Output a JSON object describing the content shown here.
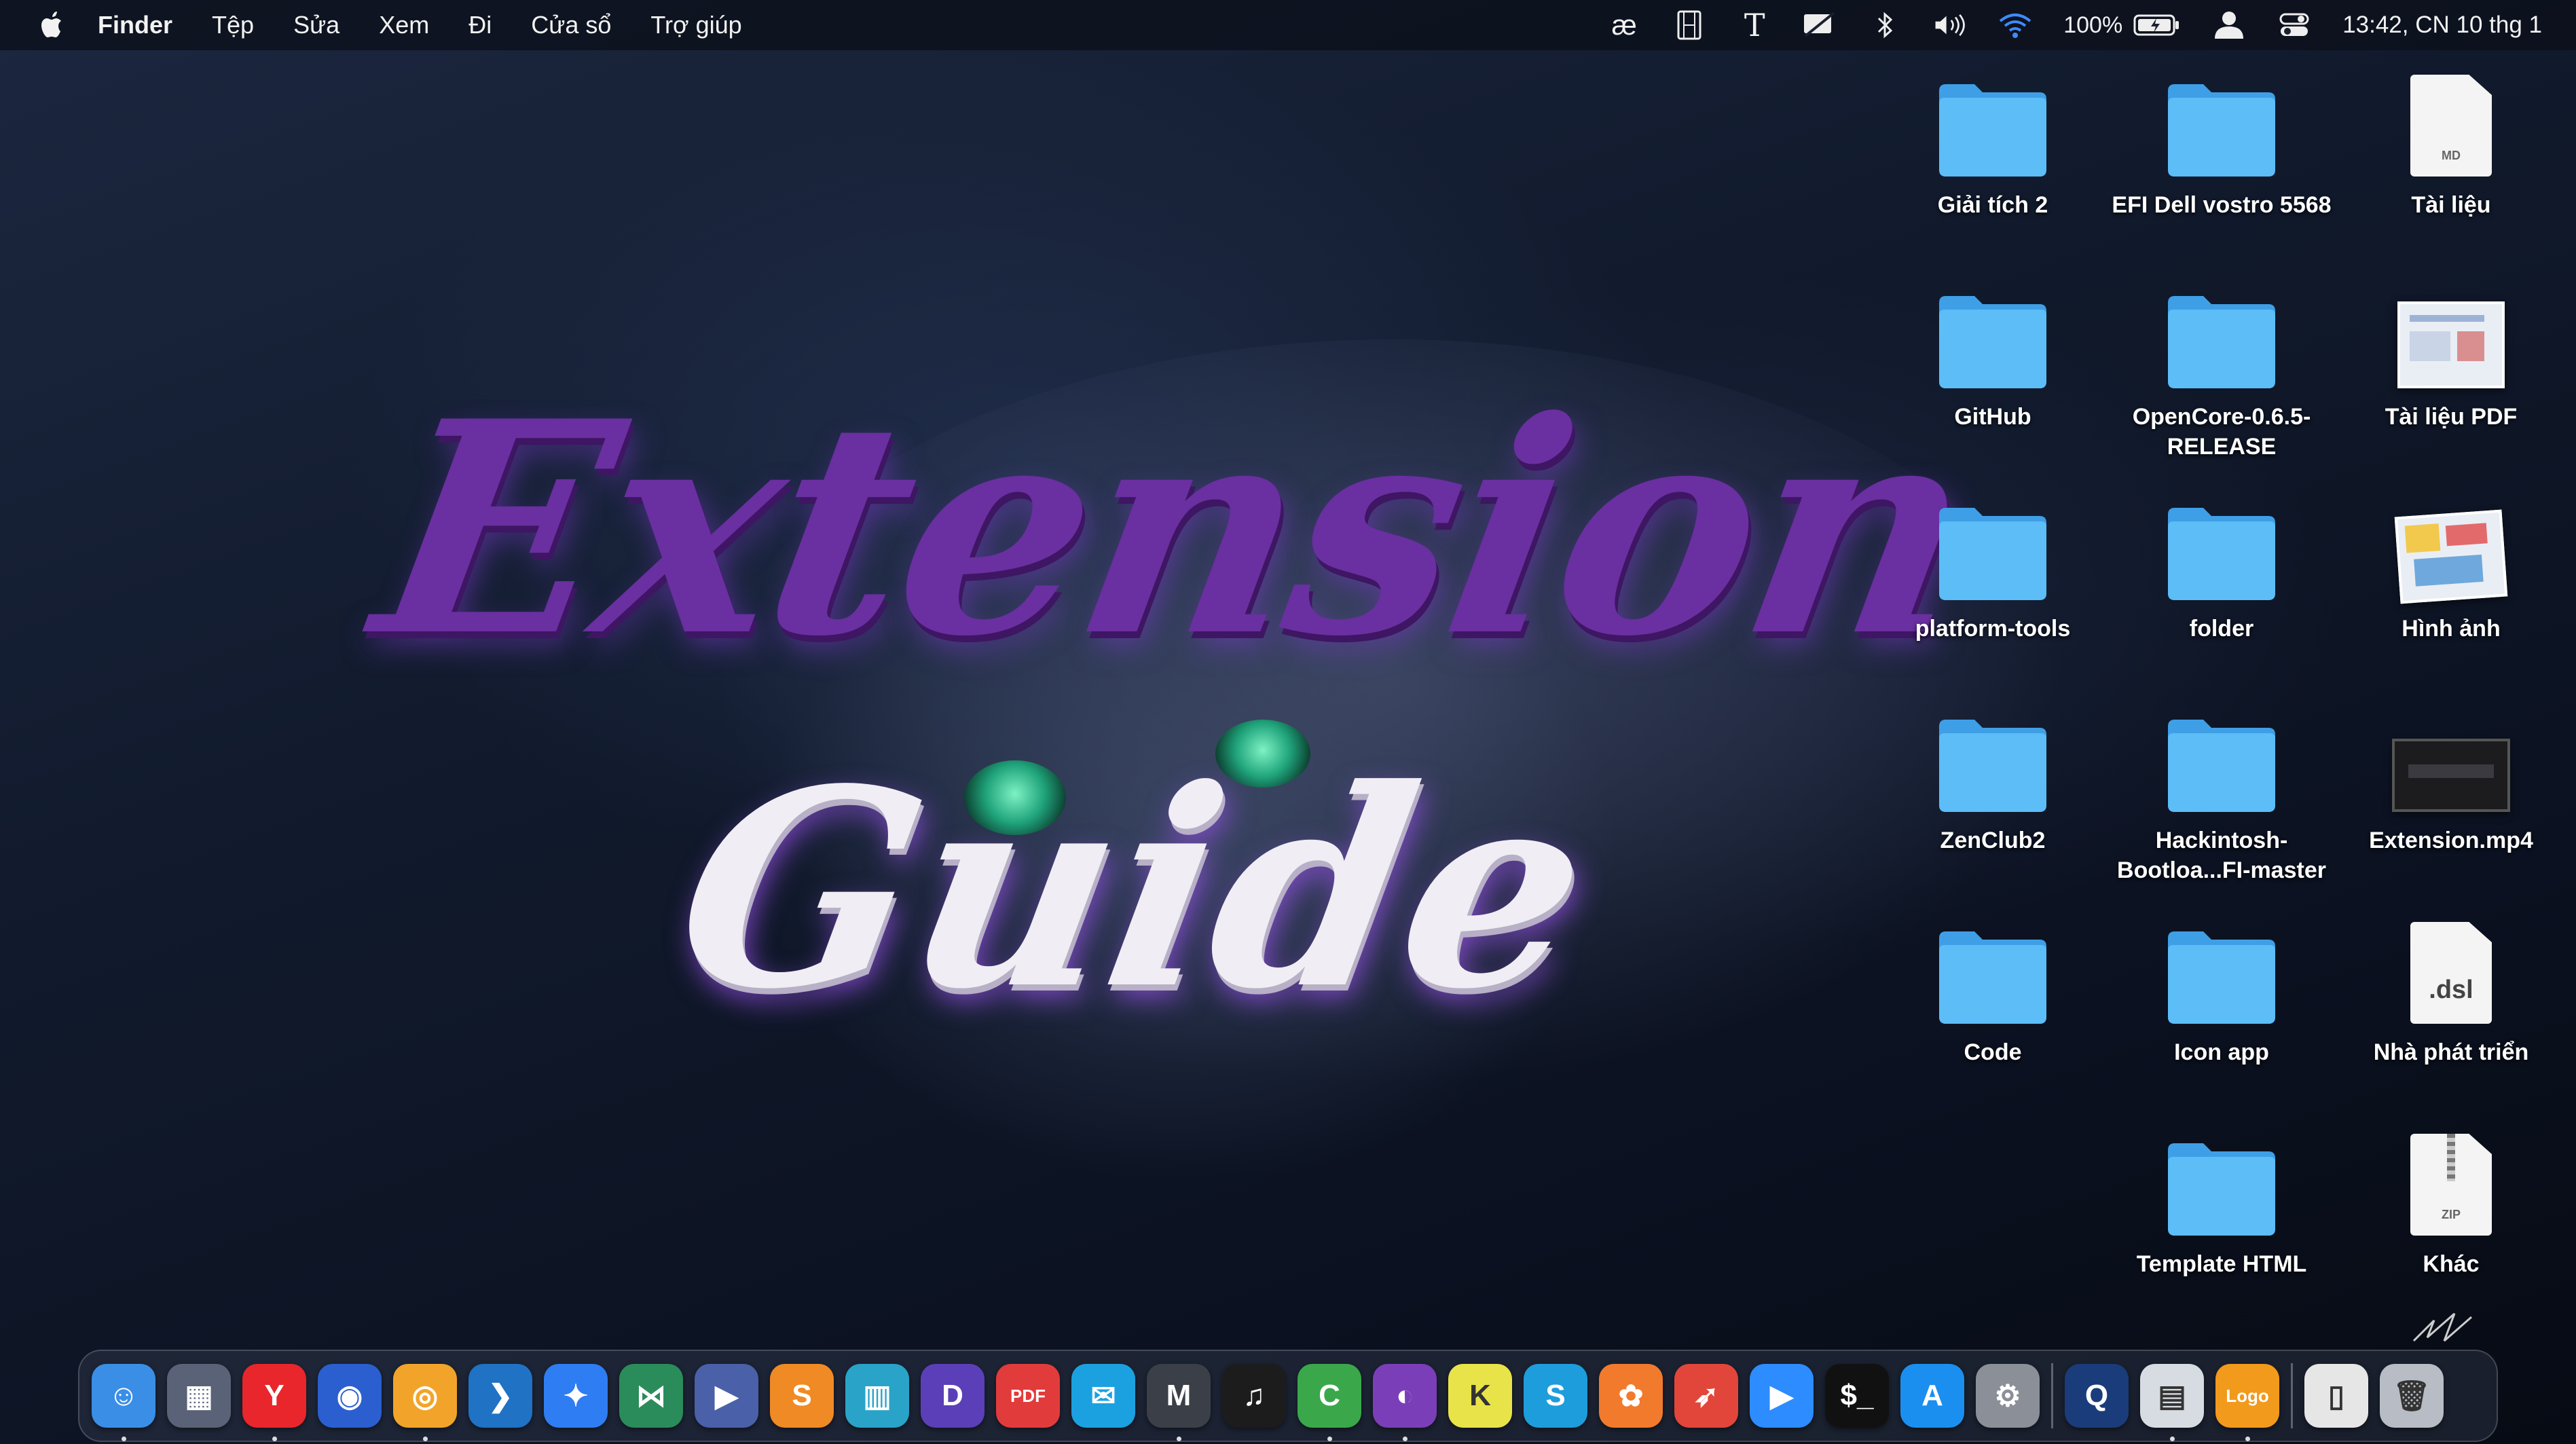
{
  "menubar": {
    "app_name": "Finder",
    "menus": [
      "Tệp",
      "Sửa",
      "Xem",
      "Đi",
      "Cửa sổ",
      "Trợ giúp"
    ],
    "status_icons": [
      "text-input-icon",
      "film-icon",
      "type-icon",
      "notification-icon",
      "bluetooth-icon",
      "volume-icon",
      "wifi-icon"
    ],
    "battery_percent": "100%",
    "datetime": "13:42, CN 10 thg 1"
  },
  "wallpaper": {
    "line1": "Extension",
    "line2": "Guide"
  },
  "desktop": {
    "items": [
      {
        "label": "Giải tích 2",
        "type": "folder"
      },
      {
        "label": "EFI Dell vostro 5568",
        "type": "folder"
      },
      {
        "label": "Tài liệu",
        "type": "document",
        "tag": "MD"
      },
      {
        "label": "GitHub",
        "type": "folder"
      },
      {
        "label": "OpenCore-0.6.5-RELEASE",
        "type": "folder"
      },
      {
        "label": "Tài liệu PDF",
        "type": "thumbnail"
      },
      {
        "label": "platform-tools",
        "type": "folder"
      },
      {
        "label": "folder",
        "type": "folder"
      },
      {
        "label": "Hình ảnh",
        "type": "thumbnail"
      },
      {
        "label": "ZenClub2",
        "type": "folder"
      },
      {
        "label": "Hackintosh-Bootloa...FI-master",
        "type": "folder"
      },
      {
        "label": "Extension.mp4",
        "type": "video"
      },
      {
        "label": "Code",
        "type": "folder"
      },
      {
        "label": "Icon app",
        "type": "folder"
      },
      {
        "label": "Nhà phát triển",
        "type": "document",
        "tag": ".dsl"
      },
      {
        "label": "Template HTML",
        "type": "folder"
      },
      {
        "label": "Khác",
        "type": "document",
        "tag": "ZIP"
      }
    ]
  },
  "dock": {
    "apps": [
      {
        "name": "finder-icon",
        "color": "#3a8ee6",
        "glyph": "☺",
        "running": true
      },
      {
        "name": "launchpad-icon",
        "color": "#5a6278",
        "glyph": "▦",
        "running": false
      },
      {
        "name": "yandex-browser-icon",
        "color": "#e8262b",
        "glyph": "Y",
        "running": true
      },
      {
        "name": "firefox-icon",
        "color": "#2b5fd0",
        "glyph": "◉",
        "running": false
      },
      {
        "name": "chrome-canary-icon",
        "color": "#f2a42a",
        "glyph": "◎",
        "running": true
      },
      {
        "name": "vscode-icon",
        "color": "#1f72c4",
        "glyph": "❯",
        "running": false
      },
      {
        "name": "messenger-icon",
        "color": "#2f7df2",
        "glyph": "✦",
        "running": false
      },
      {
        "name": "visual-studio-icon",
        "color": "#2a8c5a",
        "glyph": "⋈",
        "running": false
      },
      {
        "name": "prompt-icon",
        "color": "#4a60a8",
        "glyph": "▶",
        "running": false
      },
      {
        "name": "sublime-text-icon",
        "color": "#f08a24",
        "glyph": "S",
        "running": false
      },
      {
        "name": "sidebar-app-icon",
        "color": "#2aa3c8",
        "glyph": "▥",
        "running": false
      },
      {
        "name": "dictionary-icon",
        "color": "#5b3fb8",
        "glyph": "D",
        "running": false
      },
      {
        "name": "pdf-expert-icon",
        "color": "#e23b3b",
        "glyph": "PDF",
        "running": false
      },
      {
        "name": "mailspring-icon",
        "color": "#1ca1e0",
        "glyph": "✉",
        "running": false
      },
      {
        "name": "monitor-app-icon",
        "color": "#3b3f48",
        "glyph": "M",
        "running": true
      },
      {
        "name": "spotify-icon",
        "color": "#1c1c1c",
        "glyph": "♫",
        "running": false
      },
      {
        "name": "codeshot-icon",
        "color": "#3aa84a",
        "glyph": "C",
        "running": true
      },
      {
        "name": "github-desktop-icon",
        "color": "#7a3fb8",
        "glyph": "◐",
        "running": true
      },
      {
        "name": "kite-icon",
        "color": "#e9e34a",
        "glyph": "K",
        "running": false
      },
      {
        "name": "skype-icon",
        "color": "#1e9ddc",
        "glyph": "S",
        "running": false
      },
      {
        "name": "sketch-share-icon",
        "color": "#f27a2c",
        "glyph": "✿",
        "running": false
      },
      {
        "name": "rocket-typist-icon",
        "color": "#e2463a",
        "glyph": "➶",
        "running": false
      },
      {
        "name": "zoom-icon",
        "color": "#2d8cff",
        "glyph": "▶",
        "running": false
      },
      {
        "name": "terminal-icon",
        "color": "#111111",
        "glyph": "$_",
        "running": false
      },
      {
        "name": "app-store-icon",
        "color": "#1a8ff0",
        "glyph": "A",
        "running": false
      },
      {
        "name": "system-preferences-icon",
        "color": "#8a8f98",
        "glyph": "⚙",
        "running": false
      }
    ],
    "recent": [
      {
        "name": "quicktime-icon",
        "color": "#1b3c7a",
        "glyph": "Q",
        "running": false
      },
      {
        "name": "preview-icon",
        "color": "#d7dbe2",
        "glyph": "▤",
        "running": true
      },
      {
        "name": "logo-maker-icon",
        "color": "#f29a1c",
        "glyph": "Logo",
        "running": true
      }
    ],
    "end": [
      {
        "name": "documents-stack-icon",
        "color": "#e6e6e6",
        "glyph": "▯",
        "running": false
      },
      {
        "name": "trash-icon",
        "color": "#b8bcc4",
        "glyph": "🗑",
        "running": false
      }
    ]
  }
}
